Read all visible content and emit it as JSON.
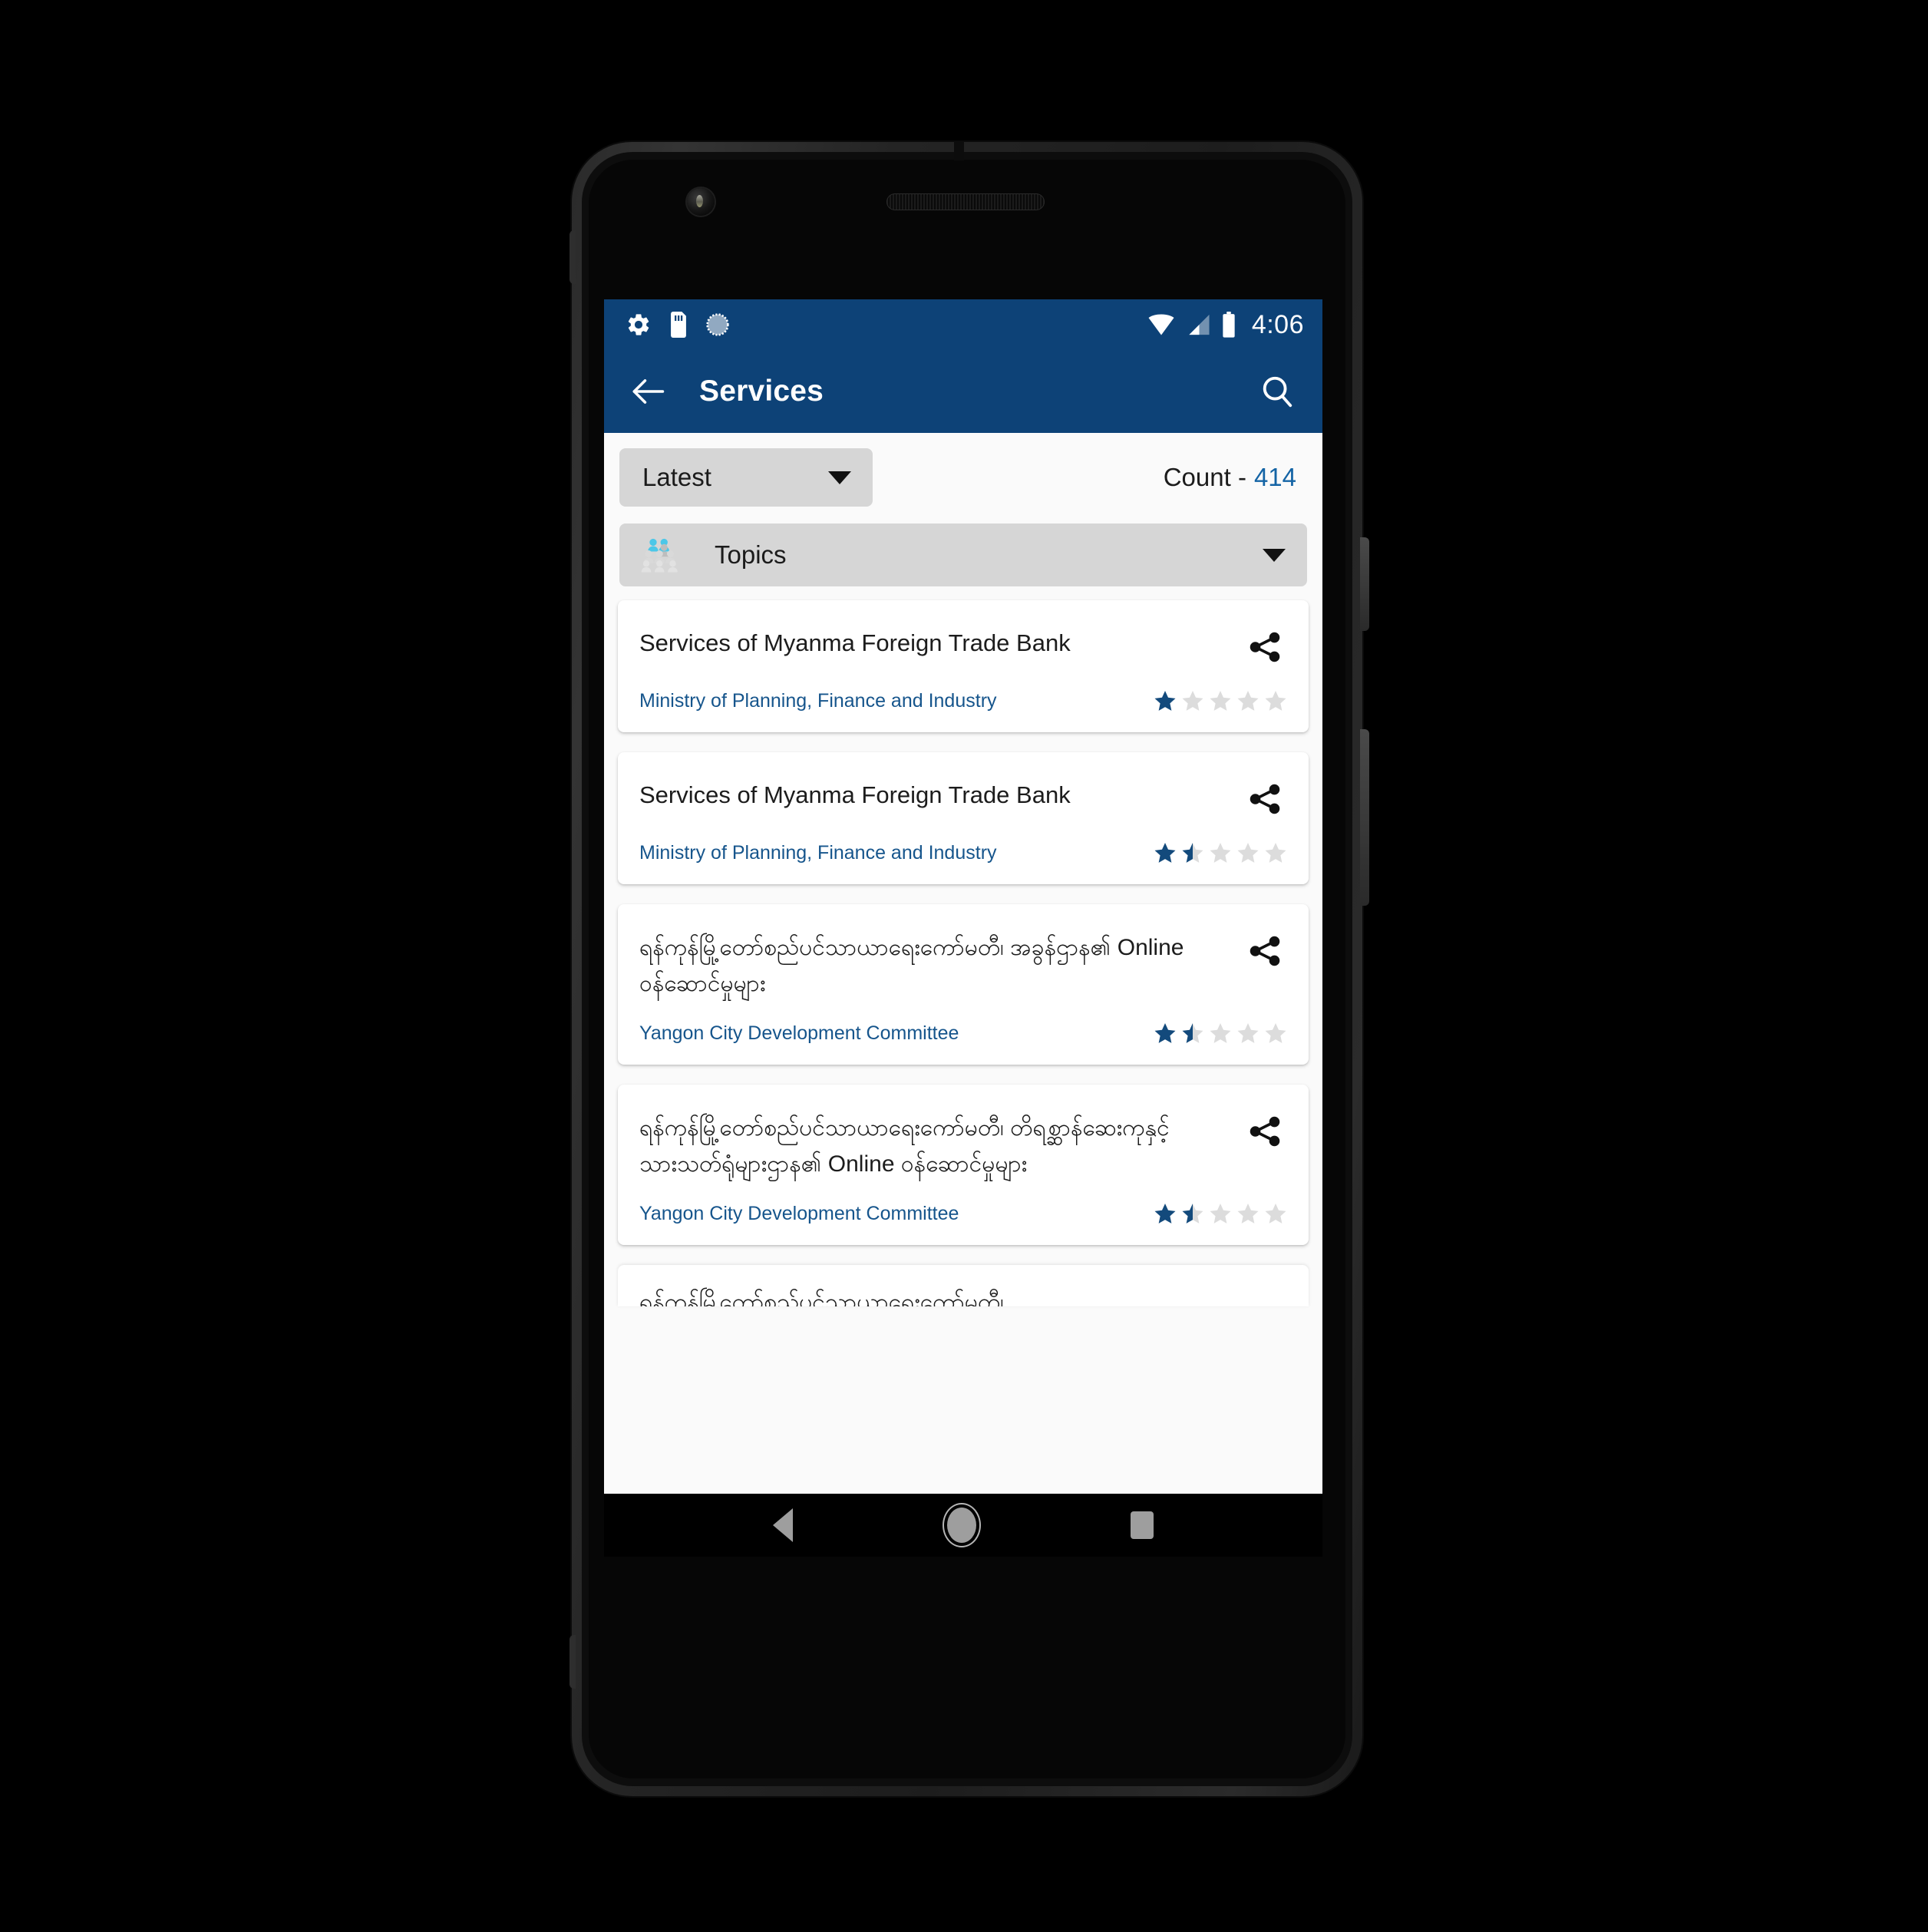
{
  "device": {
    "frame_color": "#2a2a2a",
    "screen_bg": "#fafafa"
  },
  "status_bar": {
    "background": "#0D4277",
    "time": "4:06",
    "left_icons": [
      "gear-icon",
      "sd-card-icon",
      "sync-circle-icon"
    ],
    "right_icons": [
      "wifi-icon",
      "cellular-signal-icon",
      "battery-icon"
    ]
  },
  "app_bar": {
    "background": "#0D4277",
    "back_icon": "arrow-back-icon",
    "title": "Services",
    "search_icon": "search-icon"
  },
  "filters": {
    "sort": {
      "label": "Latest",
      "caret_icon": "chevron-down-icon"
    },
    "count": {
      "label": "Count -",
      "value": "414",
      "value_color": "#1464a5"
    },
    "topics": {
      "icon": "people-group-icon",
      "label": "Topics",
      "caret_icon": "chevron-down-icon"
    }
  },
  "cards": [
    {
      "title": "Services of Myanma Foreign Trade Bank",
      "is_myanmar": false,
      "agency": "Ministry of Planning, Finance and Industry",
      "rating": 1,
      "share_icon": "share-icon"
    },
    {
      "title": "Services of Myanma Foreign Trade Bank",
      "is_myanmar": false,
      "agency": "Ministry of Planning, Finance and Industry",
      "rating": 1.5,
      "share_icon": "share-icon"
    },
    {
      "title": "ရန်ကုန်မြို့တော်စည်ပင်သာယာရေးကော်မတီ၊ အခွန်ဌာန၏ Online ဝန်ဆောင်မှုများ",
      "is_myanmar": true,
      "agency": "Yangon City Development Committee",
      "rating": 1.5,
      "share_icon": "share-icon"
    },
    {
      "title": "ရန်ကုန်မြို့တော်စည်ပင်သာယာရေးကော်မတီ၊ တိရစ္ဆာန်ဆေးကုနှင့် သားသတ်ရုံများဌာန၏ Online ဝန်ဆောင်မှုများ",
      "is_myanmar": true,
      "agency": "Yangon City Development Committee",
      "rating": 1.5,
      "share_icon": "share-icon"
    }
  ],
  "partial_card": {
    "title": "ရန်ကုန်မြို့တော်စည်ပင်သာယာရေးကော်မတီ၊"
  },
  "nav_bar": {
    "background": "#000000",
    "back_icon": "nav-back-triangle-icon",
    "home_icon": "nav-home-circle-icon",
    "recents_icon": "nav-recents-square-icon"
  },
  "colors": {
    "primary_blue": "#0D4277",
    "link_blue": "#16558c",
    "star_filled": "#134a7c",
    "star_empty": "#dcdcdc",
    "dropdown_gray": "#d6d6d6"
  }
}
